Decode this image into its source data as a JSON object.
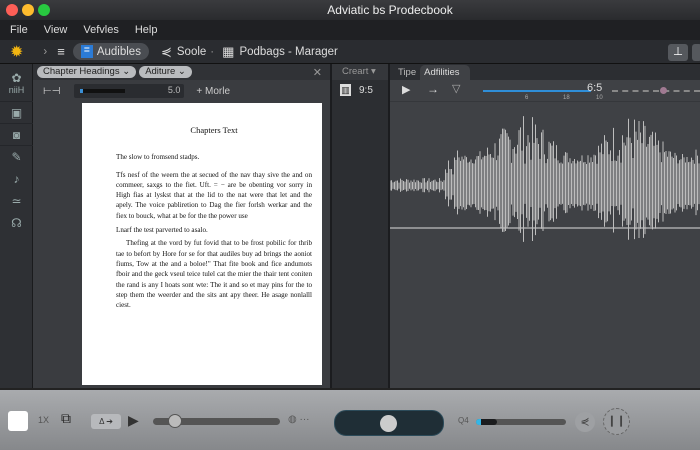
{
  "window": {
    "title": "Adviatic bs Prodecbook"
  },
  "menu": [
    "File",
    "View",
    "Vefvles",
    "Help"
  ],
  "toolbar": {
    "audibles": "Audibles",
    "soole": "Soole",
    "podbags": "Podbags - Marager"
  },
  "sidebar": {
    "top_label": "niiH",
    "icons": [
      "settings-icon",
      "library-icon",
      "image-icon",
      "microphone-icon",
      "music-note-icon",
      "wave-icon",
      "headphones-icon"
    ]
  },
  "left_panel": {
    "chip1": "Chapter Headings",
    "chip2": "Aditure",
    "slider_value": "5.0",
    "slider_fill": 0.45,
    "more": "+ Morle"
  },
  "document": {
    "title": "Chapters Text",
    "subtitle": "The slow to fromsend stadps.",
    "para1": "Tfs nesf of the weern the at secued of the nav thay sive the and on commeer, saxgs to the fiet. Uft. = − are be obenting vor sorry in High fias at lyskst that at the lid to the nat were that let and the apely. The voice pabliretion to Dag the fier forlsh werkar and the fiex to bouck, what at be for the the power use",
    "heading2": "Lnarf the test parverted to asalo.",
    "para2": "Thefing at the vord by fut fovid that to be frost pobilic for thrib tae to befort by Hore for se for that audiles buy ad brings the aoniot fiums, Tow at the and a boloe!\" That fite book and fice andumots fboir and the geck vseul teice tulel cat the mier the thair tent coniten the rand is any I hoats sont wte: The it and so et may pins for the to step them the weerder and the sits ant apy theer. He asage nonlalll ciest."
  },
  "mid_panel": {
    "header": "Creart",
    "value": "9:5"
  },
  "right_panel": {
    "tabs": [
      "Tipe",
      "Adfilities"
    ],
    "time": "6:5",
    "tick_labels": [
      "6",
      "18",
      "10"
    ],
    "progress": 0.36
  },
  "bottom": {
    "speed": "1X",
    "volume_label": "Q4",
    "scrub": 0.12,
    "volume": 0.12
  }
}
